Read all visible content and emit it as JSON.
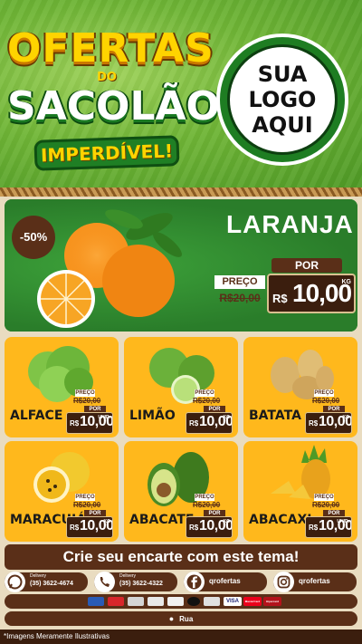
{
  "header": {
    "title_line1": "OFERTAS",
    "title_line2": "DO",
    "title_line3": "SACOLÃO",
    "badge": "IMPERDÍVEL!",
    "logo_line1": "SUA",
    "logo_line2": "LOGO",
    "logo_line3": "AQUI"
  },
  "featured": {
    "discount": "-50%",
    "name": "LARANJA",
    "preco_label": "PREÇO",
    "old_price": "R$20,00",
    "por_label": "POR",
    "currency": "R$",
    "price": "10,00",
    "unit": "KG"
  },
  "products": [
    {
      "name": "ALFACE",
      "preco_label": "PREÇO",
      "old_price": "R$20,00",
      "por_label": "POR",
      "currency": "R$",
      "price": "10,00",
      "unit": "UNID."
    },
    {
      "name": "LIMÃO",
      "preco_label": "PREÇO",
      "old_price": "R$20,00",
      "por_label": "POR",
      "currency": "R$",
      "price": "10,00",
      "unit": "KG"
    },
    {
      "name": "BATATA",
      "preco_label": "PREÇO",
      "old_price": "R$20,00",
      "por_label": "POR",
      "currency": "R$",
      "price": "10,00",
      "unit": "KG"
    },
    {
      "name": "MARACUJÁ",
      "preco_label": "PREÇO",
      "old_price": "R$20,00",
      "por_label": "POR",
      "currency": "R$",
      "price": "10,00",
      "unit": "KG"
    },
    {
      "name": "ABACATE",
      "preco_label": "PREÇO",
      "old_price": "R$20,00",
      "por_label": "POR",
      "currency": "R$",
      "price": "10,00",
      "unit": "KG"
    },
    {
      "name": "ABACAXI",
      "preco_label": "PREÇO",
      "old_price": "R$20,00",
      "por_label": "POR",
      "currency": "R$",
      "price": "10,00",
      "unit": "UNID."
    }
  ],
  "cta": "Crie seu encarte com este tema!",
  "contacts": {
    "whatsapp": {
      "label": "Delivery",
      "number": "(35) 3622-4674",
      "icon": "whatsapp-icon"
    },
    "phone": {
      "label": "Delivery",
      "number": "(35) 3622-4322",
      "icon": "phone-icon"
    },
    "facebook": {
      "handle": "qrofertas",
      "icon": "facebook-icon"
    },
    "instagram": {
      "handle": "qrofertas",
      "icon": "instagram-icon"
    }
  },
  "payments": [
    "card-1",
    "card-2",
    "card-3",
    "card-4",
    "card-5",
    "card-6",
    "card-7",
    "VISA",
    "MasterCard",
    "Hipercard"
  ],
  "address": "Rua",
  "footnote": "*Imagens Meramente Ilustrativas",
  "colors": {
    "green": "#4f9a26",
    "brown": "#5a2f18",
    "dark_brown": "#3b1e0e",
    "card": "#ffb81c",
    "yellow": "#ffd400"
  }
}
